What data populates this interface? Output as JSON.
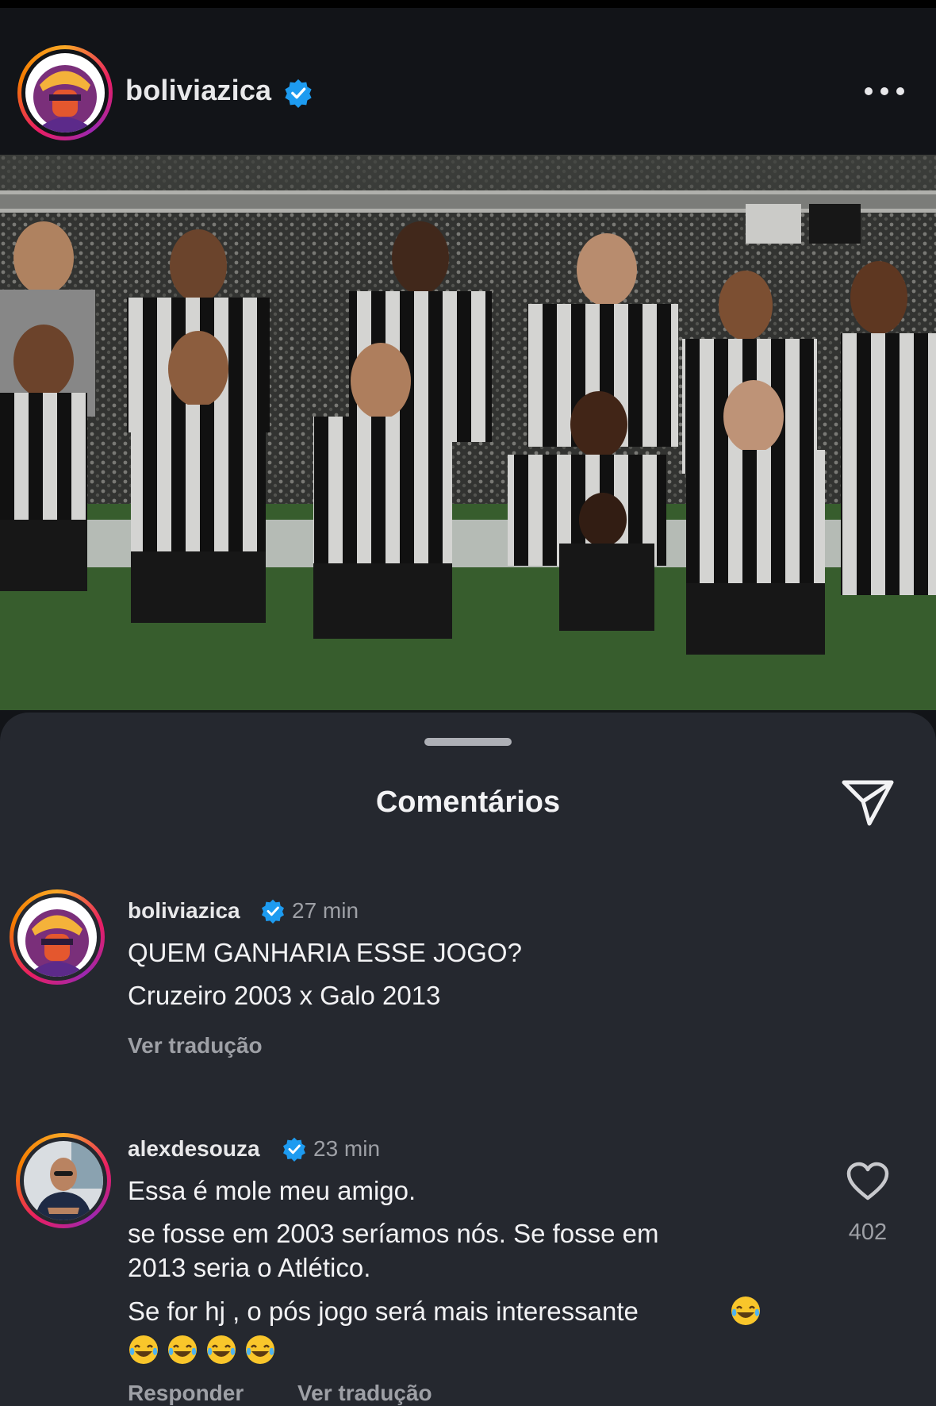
{
  "post": {
    "username": "boliviazica",
    "verified_icon": "verified-badge-icon",
    "more_icon": "more-options-icon",
    "image_alt": "team-photo"
  },
  "comments_sheet": {
    "title": "Comentários",
    "share_icon": "send-icon"
  },
  "comments": [
    {
      "username": "boliviazica",
      "time": "27 min",
      "lines": [
        "QUEM GANHARIA ESSE JOGO?",
        "Cruzeiro 2003 x Galo 2013"
      ],
      "translate_label": "Ver tradução"
    },
    {
      "username": "alexdesouza",
      "time": "23 min",
      "lines": [
        "Essa é mole meu amigo.",
        "se fosse em 2003 seríamos nós. Se fosse em",
        "2013 seria o Atlético.",
        "Se for hj , o pós jogo será mais interessante"
      ],
      "likes": "402",
      "reply_label": "Responder",
      "translate_label": "Ver tradução",
      "emoji_icon": "laughing-tears-emoji"
    }
  ],
  "colors": {
    "background": "#121418",
    "sheet": "#25282f",
    "verified": "#1d9bf0",
    "muted_text": "#9ea0a6"
  }
}
